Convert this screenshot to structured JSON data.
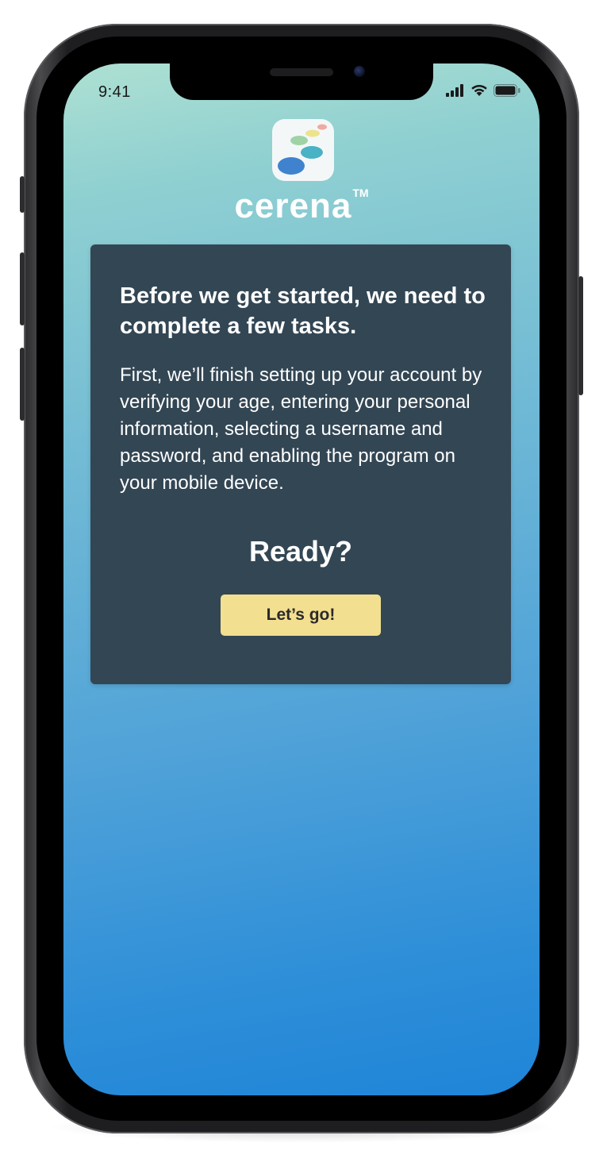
{
  "status_bar": {
    "time": "9:41"
  },
  "brand": {
    "name": "cerena",
    "trademark": "TM"
  },
  "card": {
    "heading": "Before we get started, we need to complete a few tasks.",
    "body": "First, we’ll finish setting up your account by verifying your age, entering your personal information, selecting a username and password, and enabling the program on your mobile device.",
    "prompt": "Ready?",
    "cta_label": "Let’s go!"
  },
  "colors": {
    "card_background": "#334654",
    "cta_background": "#f3df90",
    "gradient_top": "#aee0d2",
    "gradient_bottom": "#1f85d8"
  },
  "icons": {
    "status": [
      "signal-icon",
      "wifi-icon",
      "battery-icon"
    ],
    "logo": "cerena-app-logo-icon"
  }
}
